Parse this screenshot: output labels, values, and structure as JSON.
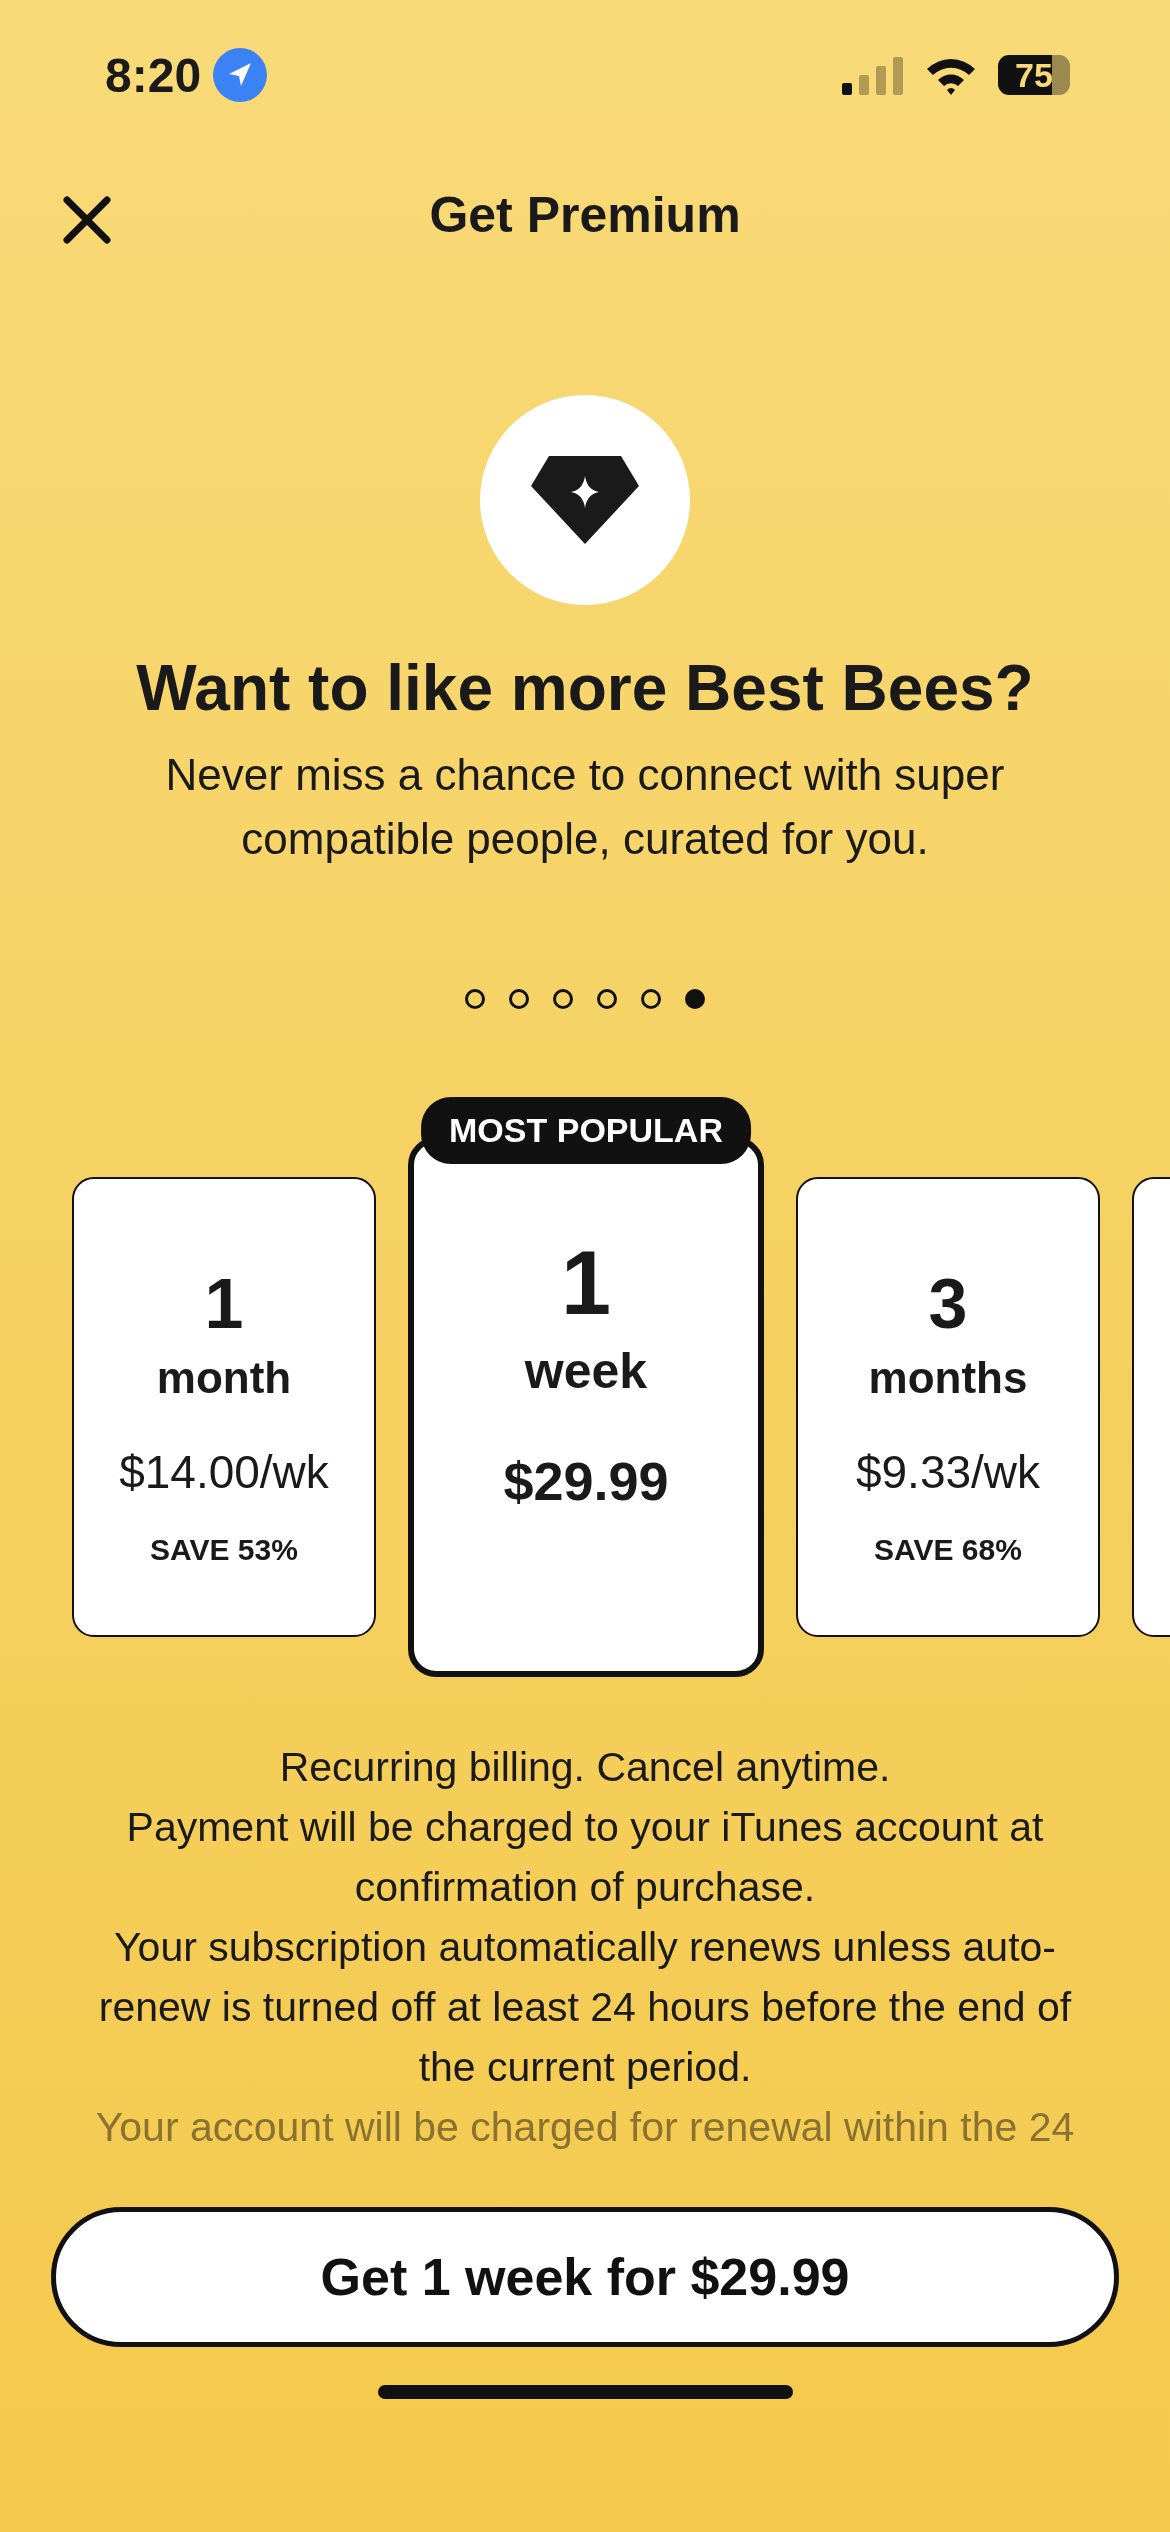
{
  "status_bar": {
    "time": "8:20",
    "battery": "75"
  },
  "header": {
    "title": "Get Premium"
  },
  "feature": {
    "headline": "Want to like more Best Bees?",
    "description": "Never miss a chance to connect with super compatible people, curated for you."
  },
  "page_dots": [
    {
      "selected": false
    },
    {
      "selected": false
    },
    {
      "selected": false
    },
    {
      "selected": false
    },
    {
      "selected": false
    },
    {
      "selected": true
    }
  ],
  "plans": [
    {
      "count": "1",
      "unit": "month",
      "price": "$14.00/wk",
      "savings": "SAVE 53%",
      "selected": false
    },
    {
      "badge": "MOST POPULAR",
      "count": "1",
      "unit": "week",
      "price": "$29.99",
      "selected": true
    },
    {
      "count": "3",
      "unit": "months",
      "price": "$9.33/wk",
      "savings": "SAVE 68%",
      "selected": false
    }
  ],
  "legal": [
    "Recurring billing. Cancel anytime.",
    "Payment will be charged to your iTunes account at confirmation of purchase.",
    "Your subscription automatically renews unless auto-renew is turned off at least 24 hours before the end of the current period.",
    "Your account will be charged for renewal within the 24"
  ],
  "cta": {
    "label": "Get 1 week for $29.99"
  }
}
